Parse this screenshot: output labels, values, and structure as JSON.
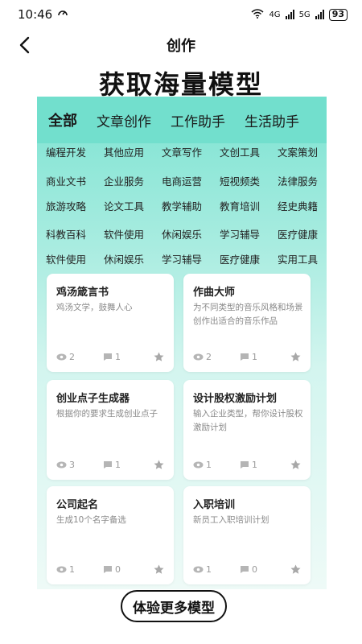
{
  "status_bar": {
    "time": "10:46",
    "network_4g": "4G",
    "network_5g": "5G",
    "battery": "93"
  },
  "nav": {
    "title": "创作"
  },
  "headline": "获取海量模型",
  "category_tabs": [
    {
      "label": "全部",
      "active": true
    },
    {
      "label": "文章创作",
      "active": false
    },
    {
      "label": "工作助手",
      "active": false
    },
    {
      "label": "生活助手",
      "active": false
    }
  ],
  "tag_rows": [
    [
      "编程开发",
      "其他应用",
      "文章写作",
      "文创工具",
      "文案策划"
    ],
    [
      "商业文书",
      "企业服务",
      "电商运营",
      "短视频类",
      "法律服务"
    ],
    [
      "旅游攻略",
      "论文工具",
      "教学辅助",
      "教育培训",
      "经史典籍"
    ],
    [
      "科教百科",
      "软件使用",
      "休闲娱乐",
      "学习辅导",
      "医疗健康"
    ],
    [
      "软件使用",
      "休闲娱乐",
      "学习辅导",
      "医疗健康",
      "实用工具"
    ]
  ],
  "cards": [
    {
      "title": "鸡汤箴言书",
      "desc": "鸡汤文学，鼓舞人心",
      "views": "2",
      "comments": "1"
    },
    {
      "title": "作曲大师",
      "desc": "为不同类型的音乐风格和场景创作出适合的音乐作品",
      "views": "2",
      "comments": "1"
    },
    {
      "title": "创业点子生成器",
      "desc": "根据你的要求生成创业点子",
      "views": "3",
      "comments": "1"
    },
    {
      "title": "设计股权激励计划",
      "desc": "输入企业类型，帮你设计股权激励计划",
      "views": "1",
      "comments": "1"
    },
    {
      "title": "公司起名",
      "desc": "生成10个名字备选",
      "views": "1",
      "comments": "0"
    },
    {
      "title": "入职培训",
      "desc": "新员工入职培训计划",
      "views": "1",
      "comments": "0"
    }
  ],
  "more_button": "体验更多模型",
  "colors": {
    "accent": "#72dfcd",
    "panel_bottom": "#eefaf7",
    "meta_gray": "#9a9a9a"
  }
}
